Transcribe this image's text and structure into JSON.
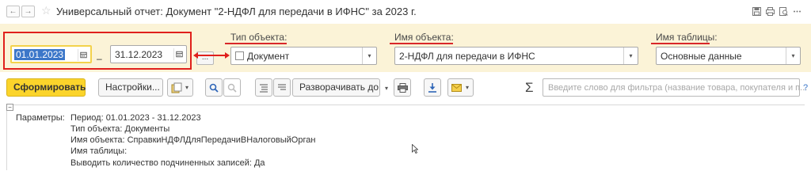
{
  "window": {
    "title": "Универсальный отчет: Документ \"2-НДФЛ для передачи в ИФНС\" за 2023 г.",
    "back_icon": "←",
    "forward_icon": "→",
    "favorite_icon": "☆"
  },
  "filters": {
    "date_from": "01.01.2023",
    "date_separator": "–",
    "date_to": "31.12.2023",
    "more_button": "...",
    "object_type": {
      "label": "Тип объекта:",
      "value": "Документ"
    },
    "object_name": {
      "label": "Имя объекта:",
      "value": "2-НДФЛ для передачи в ИФНС"
    },
    "table_name": {
      "label": "Имя таблицы:",
      "value": "Основные данные"
    },
    "annotation_color": "#e0201c"
  },
  "toolbar": {
    "generate_label": "Сформировать",
    "settings_label": "Настройки...",
    "expand_label": "Разворачивать до",
    "sigma": "Σ",
    "search_placeholder": "Введите слово для фильтра (название товара, покупателя и п...",
    "help": "?"
  },
  "report": {
    "params_label": "Параметры:",
    "lines": [
      "Период: 01.01.2023 - 31.12.2023",
      "Тип объекта: Документы",
      "Имя объекта: СправкиНДФЛДляПередачиВНалоговыйОрган",
      "Имя таблицы:",
      "Выводить количество подчиненных записей: Да"
    ]
  },
  "colors": {
    "filter_panel": "#fbf3d7",
    "primary_button": "#fbd42b",
    "selection": "#3c77c9"
  }
}
